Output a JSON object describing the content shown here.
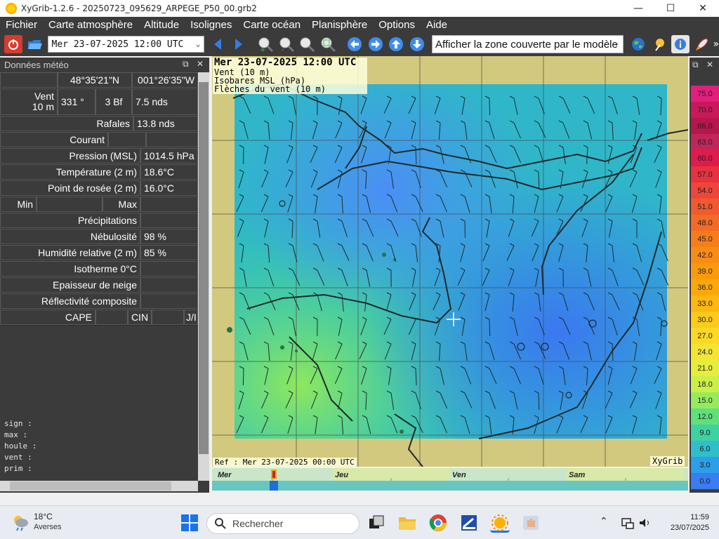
{
  "window": {
    "title": "XyGrib-1.2.6 - 20250723_095629_ARPEGE_P50_00.grb2"
  },
  "menu": [
    "Fichier",
    "Carte atmosphère",
    "Altitude",
    "Isolignes",
    "Carte océan",
    "Planisphère",
    "Options",
    "Aide"
  ],
  "toolbar": {
    "date_value": "Mer 23-07-2025 12:00 UTC",
    "zone_value": "Afficher la zone couverte par le modèle"
  },
  "panel": {
    "title": "Données météo",
    "lat": "48°35'21\"N",
    "lon": "001°26'35\"W",
    "vent_label_1": "Vent",
    "vent_label_2": "10 m",
    "vent_dir": "331 °",
    "vent_bf": "3 Bf",
    "vent_nds": "7.5  nds",
    "rafales_label": "Rafales",
    "rafales_value": "13.8  nds",
    "courant_label": "Courant",
    "pression_label": "Pression (MSL)",
    "pression_value": "1014.5 hPa",
    "temp_label": "Température (2 m)",
    "temp_value": "18.6°C",
    "rosee_label": "Point de rosée (2 m)",
    "rosee_value": "16.0°C",
    "min_label": "Min",
    "max_label": "Max",
    "precip_label": "Précipitations",
    "nebul_label": "Nébulosité",
    "nebul_value": "98 %",
    "humid_label": "Humidité relative (2 m)",
    "humid_value": "85 %",
    "iso_label": "Isotherme 0°C",
    "neige_label": "Epaisseur de neige",
    "reflect_label": "Réflectivité composite",
    "cape_label": "CAPE",
    "cin_label": "CIN",
    "ji_label": "J/I",
    "log_lines": [
      "sign :",
      "max :",
      "houle :",
      "vent :",
      "prim :"
    ]
  },
  "map": {
    "legend_date": "Mer 23-07-2025 12:00 UTC",
    "legend_1": "Vent (10 m)",
    "legend_2": "Isobares MSL (hPa)",
    "legend_3": "Flèches du vent (10 m)",
    "ref": "Ref : Mer 23-07-2025 00:00 UTC",
    "brand": "XyGrib"
  },
  "timeline": {
    "days": [
      "Mer",
      "Jeu",
      "Ven",
      "Sam"
    ]
  },
  "scale": {
    "labels": [
      "75.0",
      "70.0",
      "66.0",
      "63.0",
      "60.0",
      "57.0",
      "54.0",
      "51.0",
      "48.0",
      "45.0",
      "42.0",
      "39.0",
      "36.0",
      "33.0",
      "30.0",
      "27.0",
      "24.0",
      "21.0",
      "18.0",
      "15.0",
      "12.0",
      "9.0",
      "6.0",
      "3.0",
      "0.0"
    ],
    "colors": [
      "#e0207a",
      "#c9185c",
      "#b5164b",
      "#c0265a",
      "#e01b4a",
      "#e8323f",
      "#f0463a",
      "#f05a2e",
      "#f36b25",
      "#f77d1a",
      "#f98c12",
      "#fb9a0c",
      "#fca80a",
      "#fdb710",
      "#fdca1a",
      "#fcd927",
      "#f5e533",
      "#e5ee3c",
      "#ccef47",
      "#97ea5c",
      "#5fe07a",
      "#3fd2a1",
      "#2fbfca",
      "#2d9ee8",
      "#3a7cf2"
    ]
  },
  "taskbar": {
    "weather_temp": "18°C",
    "weather_desc": "Averses",
    "search_placeholder": "Rechercher",
    "time": "11:59",
    "date": "23/07/2025"
  }
}
